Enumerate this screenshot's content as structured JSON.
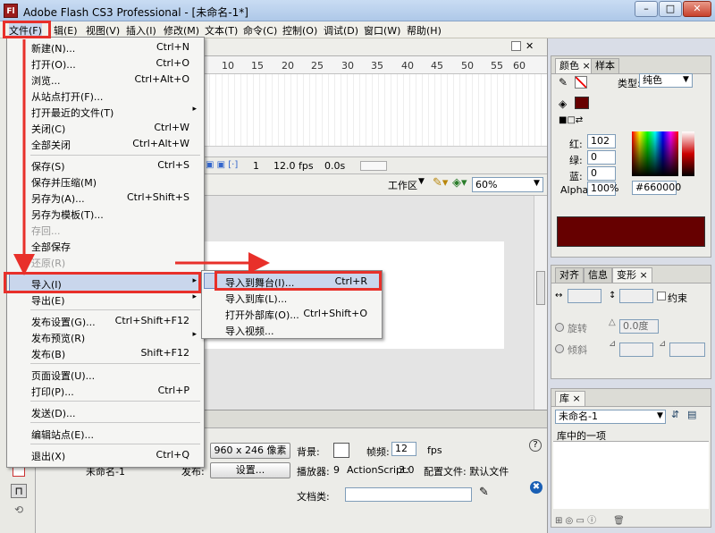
{
  "window": {
    "title": "Adobe Flash CS3 Professional - [未命名-1*]",
    "app_icon": "Fl",
    "min": "–",
    "max": "□",
    "close": "✕"
  },
  "menubar": [
    "文件(F)",
    "编辑(E)",
    "视图(V)",
    "插入(I)",
    "修改(M)",
    "文本(T)",
    "命令(C)",
    "控制(O)",
    "调试(D)",
    "窗口(W)",
    "帮助(H)"
  ],
  "menubar_visible": [
    "文件(F)",
    "辑(E)",
    "视图(V)",
    "插入(I)",
    "修改(M)",
    "文本(T)",
    "命令(C)",
    "控制(O)",
    "调试(D)",
    "窗口(W)",
    "帮助(H)"
  ],
  "timeline": {
    "ruler": [
      "10",
      "15",
      "20",
      "25",
      "30",
      "35",
      "40",
      "45",
      "50",
      "55",
      "60"
    ],
    "frame": "1",
    "fps": "12.0 fps",
    "time": "0.0s"
  },
  "editbar": {
    "workspace": "工作区",
    "zoom": "60%"
  },
  "file_menu": [
    {
      "label": "新建(N)...",
      "shortcut": "Ctrl+N"
    },
    {
      "label": "打开(O)...",
      "shortcut": "Ctrl+O"
    },
    {
      "label": "浏览...",
      "shortcut": "Ctrl+Alt+O"
    },
    {
      "label": "从站点打开(F)...",
      "shortcut": ""
    },
    {
      "label": "打开最近的文件(T)",
      "shortcut": "",
      "arrow": "▸"
    },
    {
      "label": "关闭(C)",
      "shortcut": "Ctrl+W"
    },
    {
      "label": "全部关闭",
      "shortcut": "Ctrl+Alt+W"
    },
    {
      "label": "保存(S)",
      "shortcut": "Ctrl+S"
    },
    {
      "label": "保存并压缩(M)",
      "shortcut": ""
    },
    {
      "label": "另存为(A)...",
      "shortcut": "Ctrl+Shift+S"
    },
    {
      "label": "另存为模板(T)...",
      "shortcut": ""
    },
    {
      "label": "存回...",
      "shortcut": "",
      "disabled": true
    },
    {
      "label": "全部保存",
      "shortcut": ""
    },
    {
      "label": "还原(R)",
      "shortcut": "",
      "disabled": true
    },
    {
      "label": "导入(I)",
      "shortcut": "",
      "arrow": "▸"
    },
    {
      "label": "导出(E)",
      "shortcut": "",
      "arrow": "▸"
    },
    {
      "label": "发布设置(G)...",
      "shortcut": "Ctrl+Shift+F12"
    },
    {
      "label": "发布预览(R)",
      "shortcut": "",
      "arrow": "▸"
    },
    {
      "label": "发布(B)",
      "shortcut": "Shift+F12"
    },
    {
      "label": "页面设置(U)...",
      "shortcut": ""
    },
    {
      "label": "打印(P)...",
      "shortcut": "Ctrl+P"
    },
    {
      "label": "发送(D)...",
      "shortcut": ""
    },
    {
      "label": "编辑站点(E)...",
      "shortcut": ""
    },
    {
      "label": "退出(X)",
      "shortcut": "Ctrl+Q"
    }
  ],
  "import_submenu": [
    {
      "label": "导入到舞台(I)...",
      "shortcut": "Ctrl+R"
    },
    {
      "label": "导入到库(L)...",
      "shortcut": ""
    },
    {
      "label": "打开外部库(O)...",
      "shortcut": "Ctrl+Shift+O"
    },
    {
      "label": "导入视频...",
      "shortcut": ""
    }
  ],
  "properties": {
    "doc_name": "未命名-1",
    "size_btn": "960 x 246 像素",
    "bg_label": "背景:",
    "fps_label": "帧频:",
    "fps_value": "12",
    "fps_unit": "fps",
    "publish_label": "发布:",
    "settings_btn": "设置...",
    "player_label": "播放器:",
    "player_value": "9",
    "as_label": "ActionScript:",
    "as_value": "3.0",
    "profile": "配置文件: 默认文件",
    "docclass_label": "文档类:"
  },
  "color_panel": {
    "tabs": [
      "颜色",
      "样本"
    ],
    "type_label": "类型:",
    "type_value": "纯色",
    "r_label": "红:",
    "r_value": "102",
    "g_label": "绿:",
    "g_value": "0",
    "b_label": "蓝:",
    "b_value": "0",
    "alpha_label": "Alpha:",
    "alpha_value": "100%",
    "hex": "#660000",
    "color": "#660000"
  },
  "transform_panel": {
    "tabs": [
      "对齐",
      "信息",
      "变形"
    ],
    "constrain": "约束",
    "rotate": "旋转",
    "rotate_value": "0.0度",
    "skew": "倾斜"
  },
  "library_panel": {
    "tab": "库",
    "doc": "未命名-1",
    "count": "库中的一项"
  },
  "accent": {
    "highlight": "#e8302a",
    "menu_hover": "#c9d6ec"
  }
}
